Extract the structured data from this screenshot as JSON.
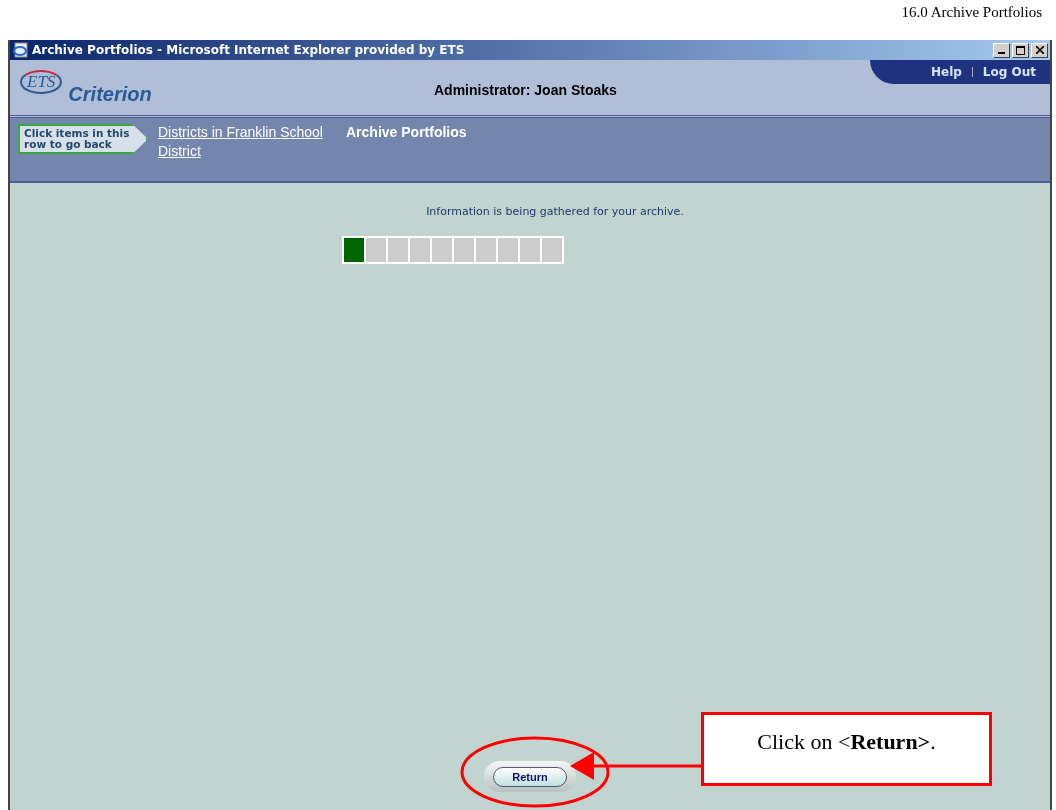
{
  "page_header": "16.0 Archive Portfolios",
  "window": {
    "title": "Archive Portfolios - Microsoft Internet Explorer provided by ETS"
  },
  "header": {
    "logo_mark": "ETS",
    "logo_text": "Criterion",
    "user": "Administrator: Joan Stoaks",
    "links": [
      "Help",
      "Log Out"
    ]
  },
  "breadcrumb": {
    "hint": "Click items in this row to go back",
    "links": [
      "Districts in Franklin School District"
    ],
    "current": "Archive Portfolios"
  },
  "status": {
    "message": "Information is being gathered for your archive.",
    "level": 0.1
  },
  "buttons": [
    "Return"
  ],
  "callout": {
    "before": "Click on <",
    "bold": "Return>",
    "after": "."
  }
}
